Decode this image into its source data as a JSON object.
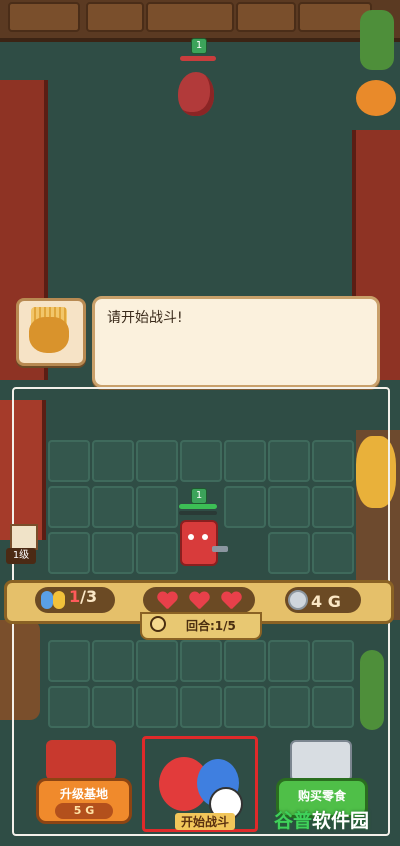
{
  "enemy": {
    "level": "1"
  },
  "player": {
    "level": "1"
  },
  "dialog": {
    "text": "请开始战斗!"
  },
  "base": {
    "level_label": "1级"
  },
  "status": {
    "population_current": "1",
    "population_sep_max": "/3",
    "hearts": 3,
    "gold": "4 G",
    "round": "回合:1/5"
  },
  "buttons": {
    "upgrade_label": "升级基地",
    "upgrade_cost": "5 G",
    "start_label": "开始战斗",
    "buy_label": "购买零食"
  },
  "watermark": {
    "part1": "谷普",
    "part2": "软件园"
  },
  "colors": {
    "frame": "#f4f1ea",
    "start_highlight": "#e02a2a",
    "upgrade": "#f08a2c",
    "buy": "#4fbf48"
  }
}
